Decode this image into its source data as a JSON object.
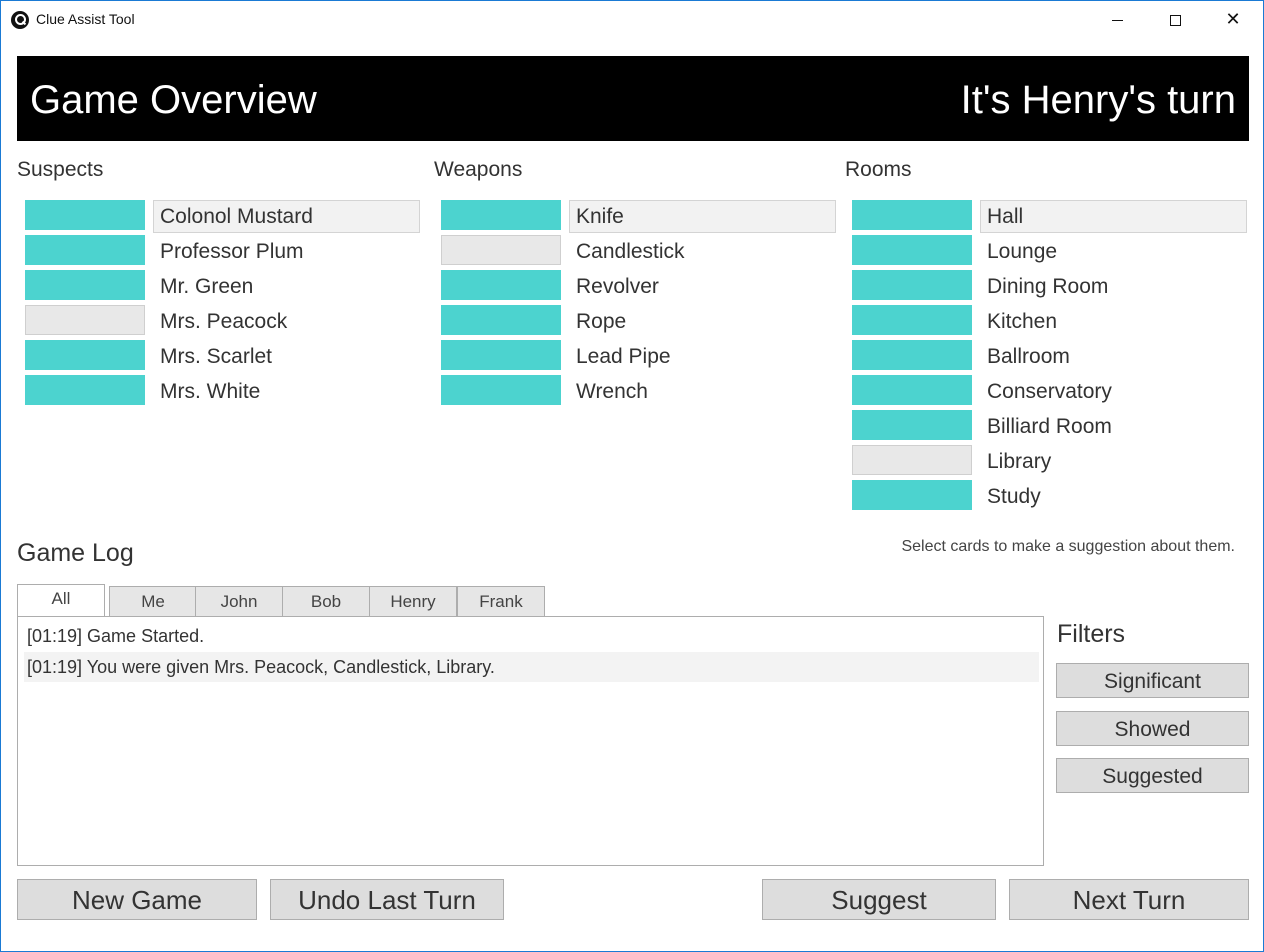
{
  "window": {
    "title": "Clue Assist Tool",
    "controls": {
      "minimize": "minimize",
      "maximize": "maximize",
      "close": "✕"
    }
  },
  "header": {
    "title": "Game Overview",
    "turn": "It's Henry's turn"
  },
  "colors": {
    "unknown": "#4cd3cf",
    "seen": "#e8e8e8",
    "header_bg": "#000000"
  },
  "suspects": {
    "title": "Suspects",
    "items": [
      {
        "label": "Colonol Mustard",
        "status": "unknown",
        "selected": true
      },
      {
        "label": "Professor Plum",
        "status": "unknown",
        "selected": false
      },
      {
        "label": "Mr. Green",
        "status": "unknown",
        "selected": false
      },
      {
        "label": "Mrs. Peacock",
        "status": "seen",
        "selected": false
      },
      {
        "label": "Mrs. Scarlet",
        "status": "unknown",
        "selected": false
      },
      {
        "label": "Mrs. White",
        "status": "unknown",
        "selected": false
      }
    ]
  },
  "weapons": {
    "title": "Weapons",
    "items": [
      {
        "label": "Knife",
        "status": "unknown",
        "selected": true
      },
      {
        "label": "Candlestick",
        "status": "seen",
        "selected": false
      },
      {
        "label": "Revolver",
        "status": "unknown",
        "selected": false
      },
      {
        "label": "Rope",
        "status": "unknown",
        "selected": false
      },
      {
        "label": "Lead Pipe",
        "status": "unknown",
        "selected": false
      },
      {
        "label": "Wrench",
        "status": "unknown",
        "selected": false
      }
    ]
  },
  "rooms": {
    "title": "Rooms",
    "items": [
      {
        "label": "Hall",
        "status": "unknown",
        "selected": true
      },
      {
        "label": "Lounge",
        "status": "unknown",
        "selected": false
      },
      {
        "label": "Dining Room",
        "status": "unknown",
        "selected": false
      },
      {
        "label": "Kitchen",
        "status": "unknown",
        "selected": false
      },
      {
        "label": "Ballroom",
        "status": "unknown",
        "selected": false
      },
      {
        "label": "Conservatory",
        "status": "unknown",
        "selected": false
      },
      {
        "label": "Billiard Room",
        "status": "unknown",
        "selected": false
      },
      {
        "label": "Library",
        "status": "seen",
        "selected": false
      },
      {
        "label": "Study",
        "status": "unknown",
        "selected": false
      }
    ]
  },
  "hint": "Select cards to make a suggestion about them.",
  "log": {
    "title": "Game Log",
    "tabs": [
      "All",
      "Me",
      "John",
      "Bob",
      "Henry",
      "Frank"
    ],
    "active_tab": "All",
    "entries": [
      "[01:19] Game Started.",
      "[01:19] You were given Mrs. Peacock, Candlestick, Library."
    ]
  },
  "filters": {
    "title": "Filters",
    "buttons": [
      "Significant",
      "Showed",
      "Suggested"
    ]
  },
  "actions": {
    "new_game": "New Game",
    "undo": "Undo Last Turn",
    "suggest": "Suggest",
    "next_turn": "Next Turn"
  }
}
